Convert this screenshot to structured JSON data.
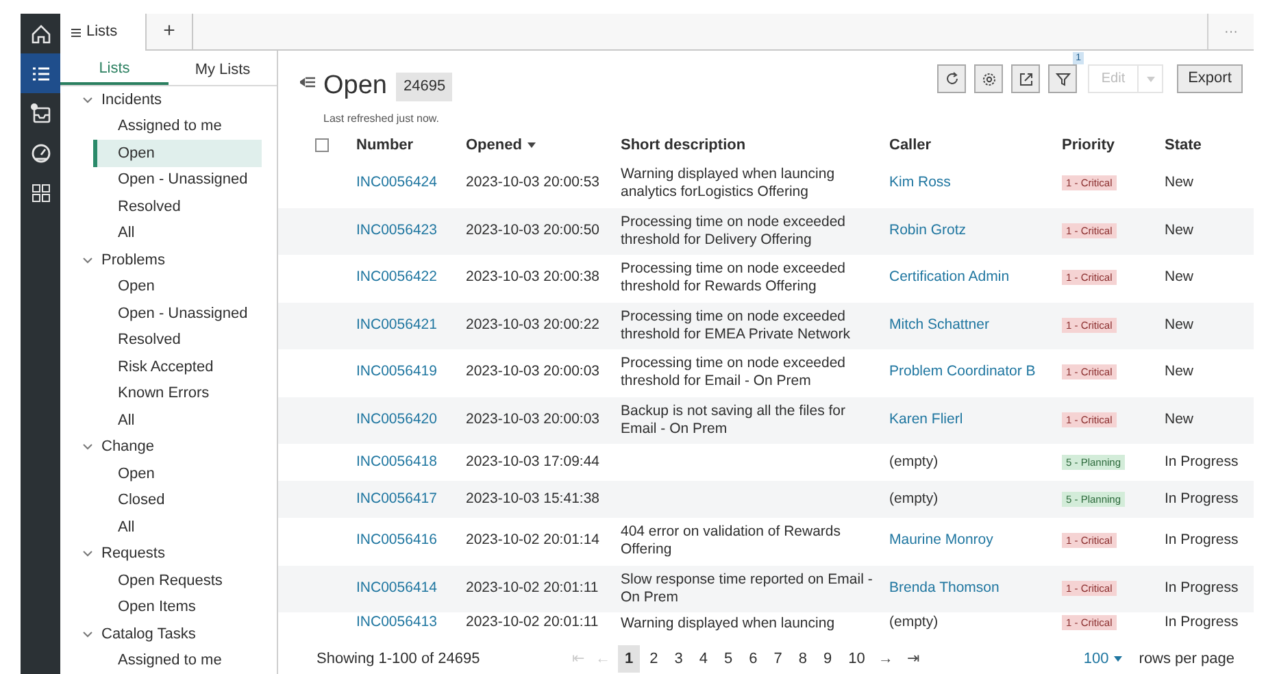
{
  "nav_rail": [
    {
      "selected": false
    },
    {
      "selected": true
    },
    {
      "selected": false,
      "dot": true
    },
    {
      "selected": false
    },
    {
      "selected": false
    }
  ],
  "tabs": [
    {
      "label": "Lists",
      "selected": true
    },
    {
      "label": "+",
      "selected": false
    }
  ],
  "overflow_menu": "···",
  "sidebar": {
    "tabs": [
      {
        "label": "Lists",
        "selected": true
      },
      {
        "label": "My Lists",
        "selected": false
      }
    ],
    "tree": [
      {
        "label": "Incidents",
        "expanded": true,
        "children": [
          {
            "label": "Assigned to me",
            "selected": false
          },
          {
            "label": "Open",
            "selected": true
          },
          {
            "label": "Open - Unassigned",
            "selected": false
          },
          {
            "label": "Resolved",
            "selected": false
          },
          {
            "label": "All",
            "selected": false
          }
        ]
      },
      {
        "label": "Problems",
        "expanded": true,
        "children": [
          {
            "label": "Open",
            "selected": false
          },
          {
            "label": "Open - Unassigned",
            "selected": false
          },
          {
            "label": "Resolved",
            "selected": false
          },
          {
            "label": "Risk Accepted",
            "selected": false
          },
          {
            "label": "Known Errors",
            "selected": false
          },
          {
            "label": "All",
            "selected": false
          }
        ]
      },
      {
        "label": "Change",
        "expanded": true,
        "children": [
          {
            "label": "Open",
            "selected": false
          },
          {
            "label": "Closed",
            "selected": false
          },
          {
            "label": "All",
            "selected": false
          }
        ]
      },
      {
        "label": "Requests",
        "expanded": true,
        "children": [
          {
            "label": "Open Requests",
            "selected": false
          },
          {
            "label": "Open Items",
            "selected": false
          }
        ]
      },
      {
        "label": "Catalog Tasks",
        "expanded": true,
        "children": [
          {
            "label": "Assigned to me",
            "selected": false
          }
        ]
      }
    ]
  },
  "list": {
    "title": "Open",
    "count": "24695",
    "subtitle": "Last refreshed just now.",
    "toolbar": {
      "filter_badge": "1",
      "edit": {
        "label": "Edit",
        "disabled": true
      },
      "export": {
        "label": "Export"
      }
    },
    "select_all": {
      "checked": false
    },
    "columns": [
      {
        "label": "Number",
        "sorted": false
      },
      {
        "label": "Opened",
        "sorted": true
      },
      {
        "label": "Short description",
        "sorted": false
      },
      {
        "label": "Caller",
        "sorted": false
      },
      {
        "label": "Priority",
        "sorted": false
      },
      {
        "label": "State",
        "sorted": false
      }
    ],
    "rows": [
      {
        "number": "INC0056424",
        "opened": "2023-10-03 20:00:53",
        "description": "Warning displayed when launcing analytics forLogistics Offering",
        "caller": {
          "text": "Kim Ross",
          "link": true
        },
        "priority": {
          "text": "1 - Critical",
          "color": "#f5d3d3"
        },
        "state": "New"
      },
      {
        "number": "INC0056423",
        "opened": "2023-10-03 20:00:50",
        "description": "Processing time on node exceeded threshold for Delivery Offering",
        "caller": {
          "text": "Robin Grotz",
          "link": true
        },
        "priority": {
          "text": "1 - Critical",
          "color": "#f5d3d3"
        },
        "state": "New"
      },
      {
        "number": "INC0056422",
        "opened": "2023-10-03 20:00:38",
        "description": "Processing time on node exceeded threshold for Rewards Offering",
        "caller": {
          "text": "Certification Admin",
          "link": true
        },
        "priority": {
          "text": "1 - Critical",
          "color": "#f5d3d3"
        },
        "state": "New"
      },
      {
        "number": "INC0056421",
        "opened": "2023-10-03 20:00:22",
        "description": "Processing time on node exceeded threshold for EMEA Private Network",
        "caller": {
          "text": "Mitch Schattner",
          "link": true
        },
        "priority": {
          "text": "1 - Critical",
          "color": "#f5d3d3"
        },
        "state": "New"
      },
      {
        "number": "INC0056419",
        "opened": "2023-10-03 20:00:03",
        "description": "Processing time on node exceeded threshold for Email - On Prem",
        "caller": {
          "text": "Problem Coordinator B",
          "link": true
        },
        "priority": {
          "text": "1 - Critical",
          "color": "#f5d3d3"
        },
        "state": "New"
      },
      {
        "number": "INC0056420",
        "opened": "2023-10-03 20:00:03",
        "description": "Backup is not saving all the files for Email - On Prem",
        "caller": {
          "text": "Karen Flierl",
          "link": true
        },
        "priority": {
          "text": "1 - Critical",
          "color": "#f5d3d3"
        },
        "state": "New"
      },
      {
        "number": "INC0056418",
        "opened": "2023-10-03 17:09:44",
        "caller": {
          "text": "(empty)",
          "link": false
        },
        "priority": {
          "text": "5 - Planning",
          "color": "#d3ecd9"
        },
        "state": "In Progress"
      },
      {
        "number": "INC0056417",
        "opened": "2023-10-03 15:41:38",
        "caller": {
          "text": "(empty)",
          "link": false
        },
        "priority": {
          "text": "5 - Planning",
          "color": "#d3ecd9"
        },
        "state": "In Progress"
      },
      {
        "number": "INC0056416",
        "opened": "2023-10-02 20:01:14",
        "description": "404 error on validation of Rewards Offering",
        "caller": {
          "text": "Maurine Monroy",
          "link": true
        },
        "priority": {
          "text": "1 - Critical",
          "color": "#f5d3d3"
        },
        "state": "In Progress"
      },
      {
        "number": "INC0056414",
        "opened": "2023-10-02 20:01:11",
        "description": "Slow response time reported on Email - On Prem",
        "caller": {
          "text": "Brenda Thomson",
          "link": true
        },
        "priority": {
          "text": "1 - Critical",
          "color": "#f5d3d3"
        },
        "state": "In Progress"
      },
      {
        "number": "INC0056413",
        "opened": "2023-10-02 20:01:11",
        "description": "Warning displayed when launcing",
        "caller": {
          "text": "(empty)",
          "link": false
        },
        "priority": {
          "text": "1 - Critical",
          "color": "#f5d3d3"
        },
        "state": "In Progress"
      }
    ],
    "footer": {
      "showing": "Showing 1-100 of 24695",
      "nav_back": [
        {
          "label": "⇤",
          "disabled": true
        },
        {
          "label": "←",
          "disabled": true
        }
      ],
      "pages": [
        {
          "label": "1",
          "selected": true
        },
        {
          "label": "2",
          "selected": false
        },
        {
          "label": "3",
          "selected": false
        },
        {
          "label": "4",
          "selected": false
        },
        {
          "label": "5",
          "selected": false
        },
        {
          "label": "6",
          "selected": false
        },
        {
          "label": "7",
          "selected": false
        },
        {
          "label": "8",
          "selected": false
        },
        {
          "label": "9",
          "selected": false
        },
        {
          "label": "10",
          "selected": false
        }
      ],
      "nav_forward": [
        {
          "label": "→",
          "disabled": false
        },
        {
          "label": "⇥",
          "disabled": false
        }
      ],
      "rows_per_page": "100",
      "rows_per_page_label": "rows per page"
    }
  }
}
